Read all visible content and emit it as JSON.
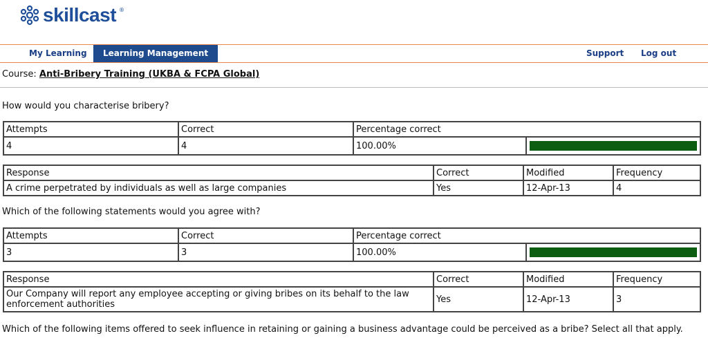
{
  "logo": {
    "text": "skillcast",
    "reg": "®"
  },
  "nav": {
    "my_learning": "My Learning",
    "learning_management": "Learning Management",
    "support": "Support",
    "logout": "Log out"
  },
  "course": {
    "label": "Course:",
    "name": "Anti-Bribery Training (UKBA & FCPA Global)"
  },
  "questions": [
    {
      "text": "How would you characterise bribery?",
      "stats_headers": [
        "Attempts",
        "Correct",
        "Percentage correct"
      ],
      "attempts": "4",
      "correct": "4",
      "percentage": "100.00%",
      "fraction_correct": 1.0,
      "response_headers": [
        "Response",
        "Correct",
        "Modified",
        "Frequency"
      ],
      "responses": [
        {
          "response": "A crime perpetrated by individuals as well as large companies",
          "correct": "Yes",
          "modified": "12-Apr-13",
          "frequency": "4"
        }
      ]
    },
    {
      "text": "Which of the following statements would you agree with?",
      "stats_headers": [
        "Attempts",
        "Correct",
        "Percentage correct"
      ],
      "attempts": "3",
      "correct": "3",
      "percentage": "100.00%",
      "fraction_correct": 1.0,
      "response_headers": [
        "Response",
        "Correct",
        "Modified",
        "Frequency"
      ],
      "responses": [
        {
          "response": "Our Company will report any employee accepting or giving bribes on its behalf to the law enforcement authorities",
          "correct": "Yes",
          "modified": "12-Apr-13",
          "frequency": "3"
        }
      ]
    },
    {
      "text": "Which of the following items offered to seek influence in retaining or gaining a business advantage could be perceived as a bribe? Select all that apply."
    }
  ],
  "colors": {
    "brand": "#1f4f9a",
    "nav_active": "#1e4a8e",
    "nav_border": "#e8874a",
    "bar": "#0d5e10"
  }
}
